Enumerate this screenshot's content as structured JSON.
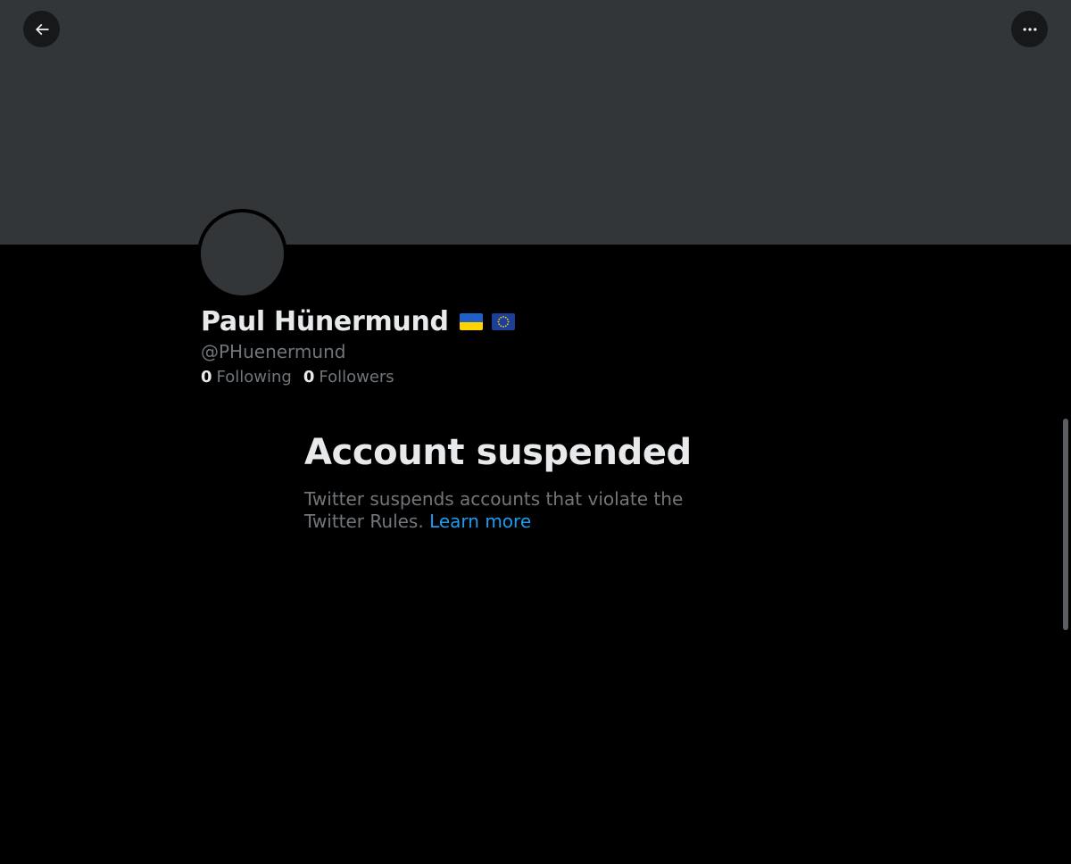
{
  "profile": {
    "display_name": "Paul Hünermund",
    "flags": [
      "ukraine-flag-icon",
      "eu-flag-icon"
    ],
    "handle": "@PHuenermund",
    "following_count": "0",
    "following_label": "Following",
    "followers_count": "0",
    "followers_label": "Followers"
  },
  "notice": {
    "title": "Account suspended",
    "body": "Twitter suspends accounts that violate the Twitter Rules.",
    "link_label": "Learn more"
  },
  "header": {
    "back_icon": "arrow-left-icon",
    "more_icon": "ellipsis-icon"
  },
  "colors": {
    "background": "#000000",
    "banner": "#333639",
    "primary_text": "#e7e9ea",
    "secondary_text": "#71767b",
    "link": "#1d9bf0"
  }
}
